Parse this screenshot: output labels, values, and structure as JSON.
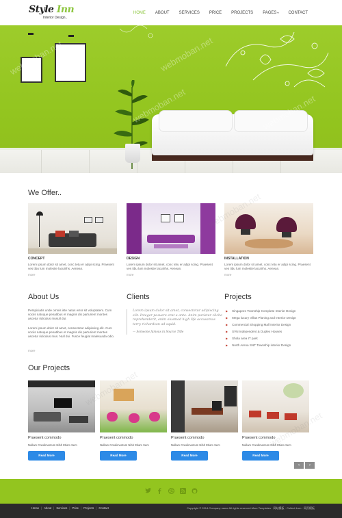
{
  "brand": {
    "logo_main_a": "Style",
    "logo_main_b": "Inn",
    "logo_sub": "Interior Design..",
    "accent_color": "#8dc63f"
  },
  "nav": {
    "items": [
      "HOME",
      "ABOUT",
      "SERVICES",
      "PRICE",
      "PROJECTS",
      "PAGES",
      "CONTACT"
    ],
    "active": "HOME",
    "dropdown_indicator": "▾"
  },
  "hero": {
    "background_color": "#93c51f",
    "watermark": "webmoban.net"
  },
  "offer": {
    "title": "We Offer..",
    "cards": [
      {
        "title": "CONCEPT",
        "text": "Lorem ipsum dolor sit amet, conc tetu er adipi scing. Praesent ves tibu lum molestie lacuiirhs. Aenean.",
        "more": "more"
      },
      {
        "title": "DESIGN",
        "text": "Lorem ipsum dolor sit amet, conc tetu er adipi scing. Praesent ves tibu lum molestie lacuiirhs. Aenean.",
        "more": "more"
      },
      {
        "title": "INSTALLATION",
        "text": "Lorem ipsum dolor sit amet, conc tetu er adipi scing. Praesent ves tibu lum molestie lacuiirhs. Aenean.",
        "more": "more"
      }
    ]
  },
  "about": {
    "title": "About Us",
    "p1": "Perspiciatis unde omnis iste natus error sit voluptatem. Cum sociis natoque penatibus et magnis dis parturient montes ascetur ridiculus musull dui.",
    "p2": "Lorem ipsum dolor sit amet, consectetur adipiscing elit. Cum sociis natoque penatibus et magnis dis parturient montes ascetur ridiculus mus. Null dui. Fusce feugiat malesuada odio.",
    "more": "more"
  },
  "clients": {
    "title": "Clients",
    "quote": "Lorem ipsum dolor sit amet, consectetur adipiscing elit. Integer posuere erat a ante. Anim pariatur cliche reprehenderit, enim eiusmod high life accusamus terry richardson ad squid.",
    "author": "— Someone famous in Source Title"
  },
  "projects_list": {
    "title": "Projects",
    "items": [
      "Singapore Township Complete Interior Design",
      "Mega luxury Villas Planing and Interior Design",
      "Commercial Shopping Mall Interior Design",
      "SVN Independent & Duplex Houses",
      "Shola area IT park",
      "North Arena SNT Township interior Design"
    ],
    "bullet": "▶"
  },
  "our_projects": {
    "title": "Our Projects",
    "cards": [
      {
        "title": "Praesent commodo",
        "text": "Nullam Condimentum Nibh Etiam Sem",
        "button": "Read More"
      },
      {
        "title": "Praesent commodo",
        "text": "Nullam Condimentum Nibh Etiam Sem",
        "button": "Read More"
      },
      {
        "title": "Praesent commodo",
        "text": "Nullam Condimentum Nibh Etiam Sem",
        "button": "Read More"
      },
      {
        "title": "Praesent commodo",
        "text": "Nullam Condimentum Nibh Etiam Sem",
        "button": "Read More"
      }
    ],
    "prev": "‹",
    "next": "›",
    "button_color": "#2d8ae6"
  },
  "footer": {
    "social": [
      "twitter-icon",
      "facebook-icon",
      "dribbble-icon",
      "rss-icon",
      "github-icon"
    ],
    "links": [
      "Home",
      "About",
      "Services",
      "Price",
      "Projects",
      "Contact"
    ],
    "separator": "|",
    "copyright": "Copyright © 2014.Company name All rights reserved.More Templates · 网站模板 · Collect from · 网页模板"
  }
}
